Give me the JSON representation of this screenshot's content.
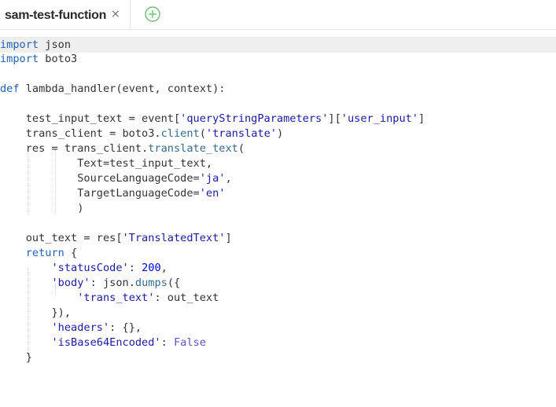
{
  "tab": {
    "title": "sam-test-function",
    "close_glyph": "×",
    "add_icon": "plus-circle-icon"
  },
  "colors": {
    "keyword": "#1f62b8",
    "string": "#1a1aa6",
    "function": "#366b8a",
    "number": "#0000cd",
    "constant": "#5a52c8",
    "text": "#333333",
    "active_line": "#efefef",
    "add_icon": "#6cc070"
  },
  "code": {
    "l1": {
      "kw": "import",
      "rest": " json"
    },
    "l2": {
      "kw": "import",
      "rest": " boto3"
    },
    "l4": {
      "kw": "def",
      "rest": " lambda_handler(event, context):"
    },
    "l6": {
      "a": "    test_input_text = event[",
      "s1": "'queryStringParameters'",
      "b": "][",
      "s2": "'user_input'",
      "c": "]"
    },
    "l7": {
      "a": "    trans_client = boto3.",
      "fn": "client",
      "b": "(",
      "s1": "'translate'",
      "c": ")"
    },
    "l8": {
      "a": "    res = trans_client.",
      "fn": "translate_text",
      "b": "("
    },
    "l9": {
      "a": "            Text=test_input_text,"
    },
    "l10": {
      "a": "            SourceLanguageCode=",
      "s1": "'ja'",
      "b": ","
    },
    "l11": {
      "a": "            TargetLanguageCode=",
      "s1": "'en'"
    },
    "l12": {
      "a": "            )"
    },
    "l14": {
      "a": "    out_text = res[",
      "s1": "'TranslatedText'",
      "b": "]"
    },
    "l15": {
      "pre": "    ",
      "kw": "return",
      "rest": " {"
    },
    "l16": {
      "pre": "        ",
      "s1": "'statusCode'",
      "b": ": ",
      "num": "200",
      "c": ","
    },
    "l17": {
      "pre": "        ",
      "s1": "'body'",
      "b": ": json.",
      "fn": "dumps",
      "c": "({"
    },
    "l18": {
      "pre": "            ",
      "s1": "'trans_text'",
      "b": ": out_text"
    },
    "l19": {
      "a": "        }),"
    },
    "l20": {
      "pre": "        ",
      "s1": "'headers'",
      "b": ": {},"
    },
    "l21": {
      "pre": "        ",
      "s1": "'isBase64Encoded'",
      "b": ": ",
      "const": "False"
    },
    "l22": {
      "a": "    }"
    }
  }
}
